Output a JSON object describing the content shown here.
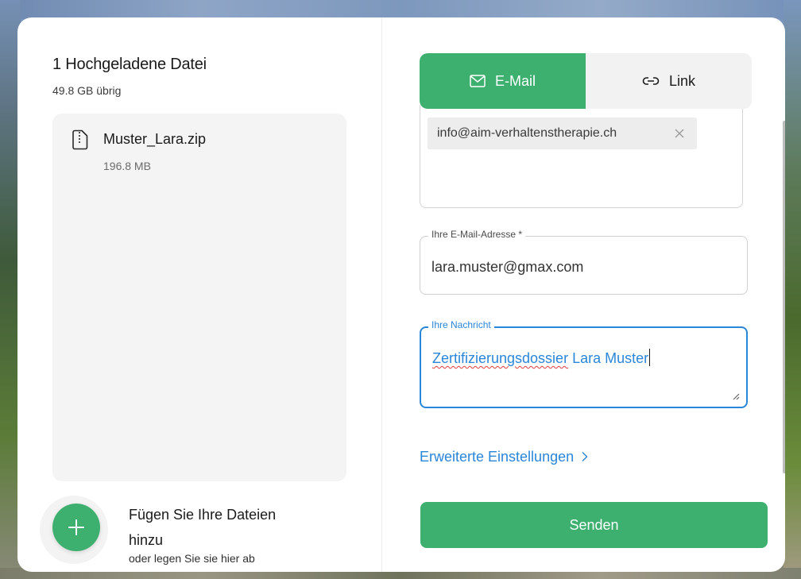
{
  "upload_panel": {
    "title": "1 Hochgeladene Datei",
    "storage_remaining": "49.8 GB übrig",
    "files": [
      {
        "name": "Muster_Lara.zip",
        "size": "196.8 MB",
        "icon": "zip-file-icon"
      }
    ],
    "add_files": {
      "title": "Fügen Sie Ihre Dateien hinzu",
      "subtitle": "oder legen Sie sie hier ab",
      "icon": "plus-icon"
    }
  },
  "transfer_panel": {
    "tabs": [
      {
        "label": "E-Mail",
        "icon": "mail-icon",
        "active": true
      },
      {
        "label": "Link",
        "icon": "link-icon",
        "active": false
      }
    ],
    "recipients": [
      {
        "email": "info@aim-verhaltenstherapie.ch"
      }
    ],
    "sender_email": {
      "label": "Ihre E-Mail-Adresse *",
      "value": "lara.muster@gmax.com"
    },
    "message": {
      "label": "Ihre Nachricht",
      "value_misspelled": "Zertifizierungsdossier",
      "value_rest": " Lara Muster"
    },
    "advanced_settings_label": "Erweiterte Einstellungen",
    "send_label": "Senden"
  },
  "colors": {
    "accent_green": "#3daf6e",
    "focus_blue": "#2a86d9"
  }
}
